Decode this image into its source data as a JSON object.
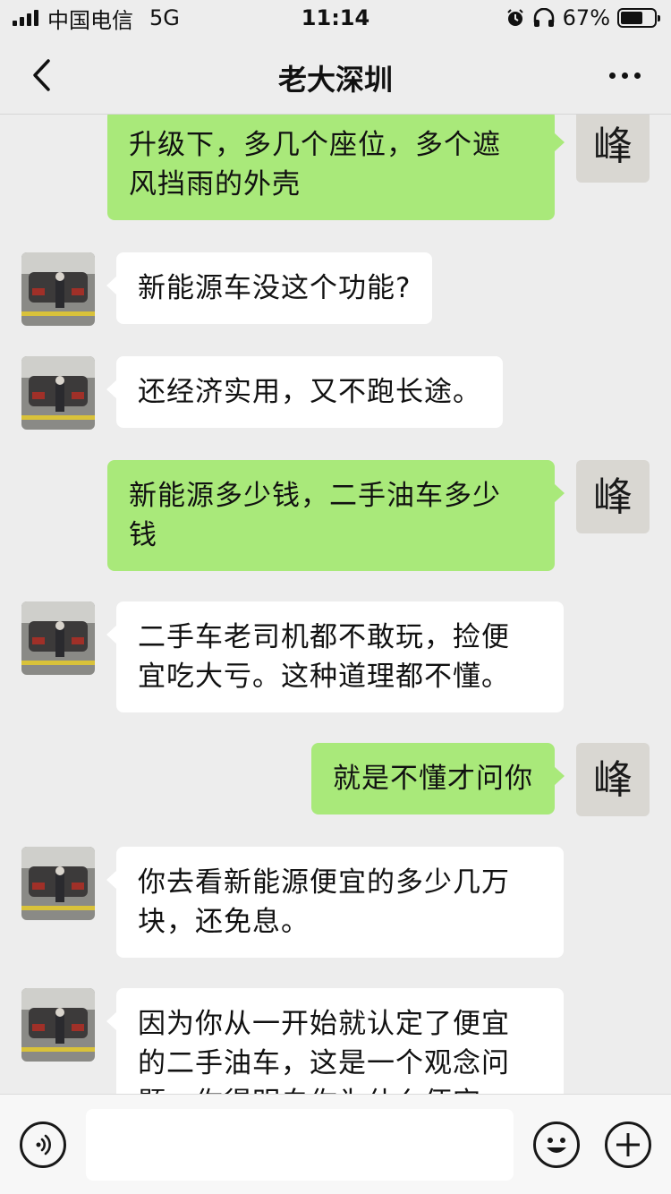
{
  "status_bar": {
    "carrier": "中国电信",
    "network": "5G",
    "time": "11:14",
    "battery_percent": "67%",
    "battery_level": 0.67,
    "icons": [
      "signal-icon",
      "alarm-icon",
      "headphones-icon",
      "battery-icon"
    ]
  },
  "header": {
    "back_icon": "chevron-left-icon",
    "title": "老大深圳",
    "more_icon": "more-dots-icon"
  },
  "messages": [
    {
      "direction": "outgoing",
      "text": "升级下，多几个座位，多个遮风挡雨的外壳",
      "lines": [
        "升级下，多几个座位，多个遮",
        "风挡雨的外壳"
      ],
      "avatar": "峰"
    },
    {
      "direction": "incoming",
      "text": "新能源车没这个功能?",
      "lines": [
        "新能源车没这个功能?"
      ],
      "avatar": "car-photo"
    },
    {
      "direction": "incoming",
      "text": "还经济实用，又不跑长途。",
      "lines": [
        "还经济实用，又不跑长途。"
      ],
      "avatar": "car-photo"
    },
    {
      "direction": "outgoing",
      "text": "新能源多少钱，二手油车多少钱",
      "lines": [
        "新能源多少钱，二手油车多少",
        "钱"
      ],
      "avatar": "峰"
    },
    {
      "direction": "incoming",
      "text": "二手车老司机都不敢玩，捡便宜吃大亏。这种道理都不懂。",
      "lines": [
        "二手车老司机都不敢玩，捡便",
        "宜吃大亏。这种道理都不懂。"
      ],
      "avatar": "car-photo"
    },
    {
      "direction": "outgoing",
      "text": "就是不懂才问你",
      "lines": [
        "就是不懂才问你"
      ],
      "avatar": "峰"
    },
    {
      "direction": "incoming",
      "text": "你去看新能源便宜的多少几万块，还免息。",
      "lines": [
        "你去看新能源便宜的多少几万",
        "块，还免息。"
      ],
      "avatar": "car-photo"
    },
    {
      "direction": "incoming",
      "text": "因为你从一开始就认定了便宜的二手油车，这是一个观念问题，你得明白你为什么便宜",
      "lines": [
        "因为你从一开始就认定了便宜",
        "的二手油车，这是一个观念问",
        "题，你得明白你为什么便宜"
      ],
      "avatar": "car-photo"
    }
  ],
  "input_bar": {
    "voice_icon": "voice-icon",
    "input_value": "",
    "input_placeholder": "",
    "emoji_icon": "emoji-icon",
    "plus_icon": "plus-icon"
  },
  "colors": {
    "background": "#ededed",
    "outgoing_bubble": "#a9e97a",
    "incoming_bubble": "#ffffff"
  }
}
